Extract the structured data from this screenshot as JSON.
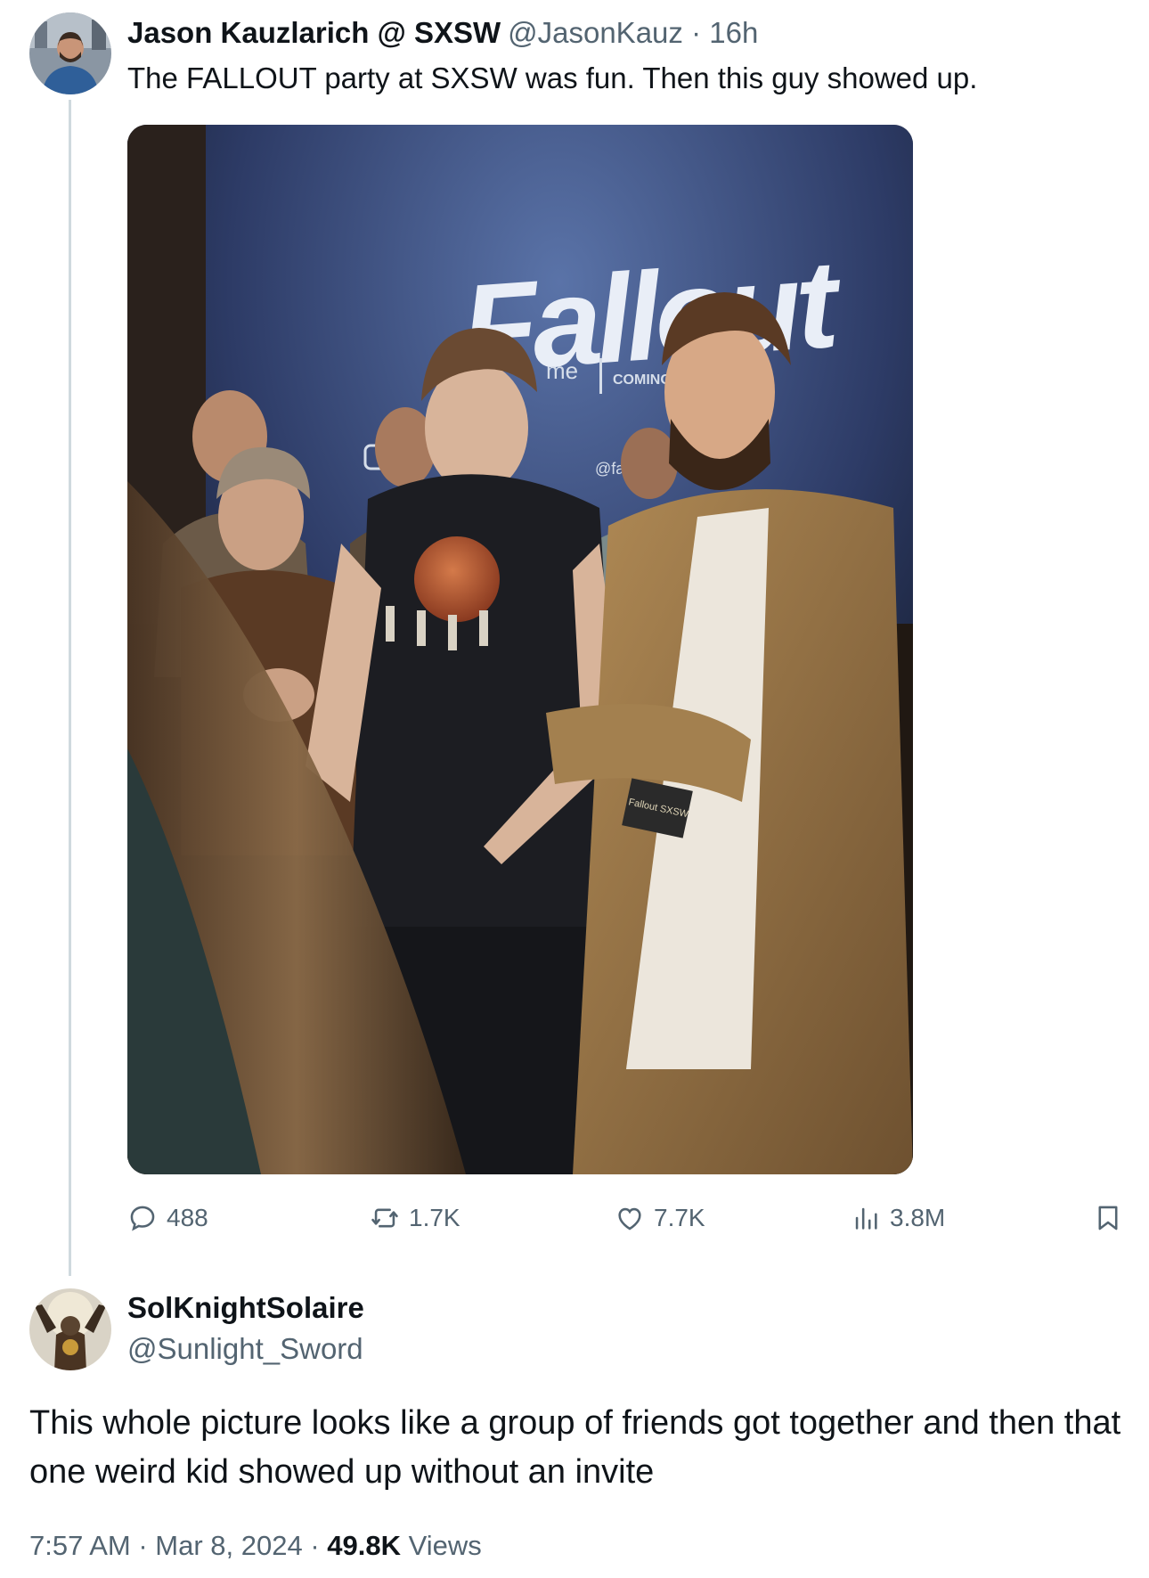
{
  "tweet": {
    "author_name": "Jason Kauzlarich @ SXSW",
    "handle": "@JasonKauz",
    "separator": "·",
    "time_ago": "16h",
    "text": "The FALLOUT party at SXSW was fun. Then this guy showed up.",
    "media": {
      "banner_title": "Fallout",
      "banner_sub_1": "me",
      "banner_sub_2": "COMING SOO",
      "banner_social": "@fallout.on",
      "lanyard_text": "Fallout SXSW"
    },
    "actions": {
      "replies": "488",
      "reposts": "1.7K",
      "likes": "7.7K",
      "views": "3.8M"
    }
  },
  "reply": {
    "author_name": "SolKnightSolaire",
    "handle": "@Sunlight_Sword",
    "text": "This whole picture looks like a group of friends got together and then that one weird kid showed up without an invite",
    "timestamp": "7:57 AM · Mar 8, 2024 ·",
    "views_count": "49.8K",
    "views_label": "Views"
  },
  "colors": {
    "text_primary": "#0f1419",
    "text_secondary": "#536471",
    "thread_line": "#cfd9de"
  },
  "icons": [
    "reply-icon",
    "retweet-icon",
    "like-icon",
    "views-icon",
    "bookmark-icon"
  ]
}
